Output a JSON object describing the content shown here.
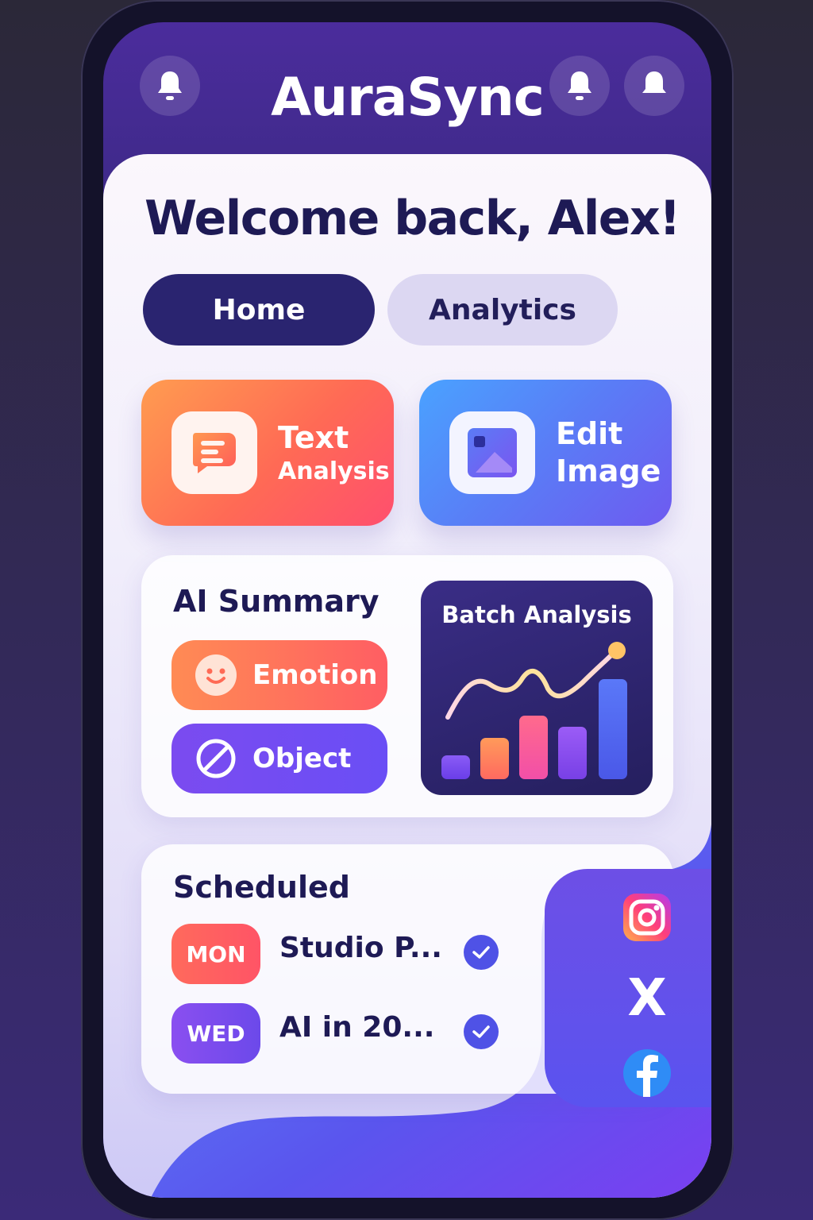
{
  "app": {
    "title": "AuraSync"
  },
  "header": {
    "left_icon": "bell-icon",
    "right_icons": [
      "bell-icon",
      "bell-icon"
    ]
  },
  "welcome": {
    "text": "Welcome back, Alex!"
  },
  "tabs": [
    {
      "label": "Home",
      "active": true
    },
    {
      "label": "Analytics",
      "active": false
    }
  ],
  "features": [
    {
      "line1": "Text",
      "line2": "Analysis",
      "icon": "text-message-icon"
    },
    {
      "line1": "Edit",
      "line2": "Image",
      "icon": "image-icon"
    }
  ],
  "summary": {
    "title": "AI Summary",
    "chips": [
      {
        "label": "Emotion",
        "icon": "smiley-icon"
      },
      {
        "label": "Object",
        "icon": "object-icon"
      }
    ]
  },
  "batch": {
    "title": "Batch Analysis"
  },
  "scheduled": {
    "title": "Scheduled",
    "items": [
      {
        "day": "MON",
        "text": "Studio P...",
        "done": true
      },
      {
        "day": "WED",
        "text": "AI in 20...",
        "done": true
      }
    ]
  },
  "social": {
    "icons": [
      "instagram-icon",
      "x-icon",
      "facebook-icon"
    ],
    "x_glyph": "X"
  },
  "colors": {
    "primary": "#2a2470",
    "accent_orange": "#ff6a55",
    "accent_blue": "#5a7cf6",
    "accent_purple": "#6c49ea",
    "text_dark": "#1e1a55"
  }
}
